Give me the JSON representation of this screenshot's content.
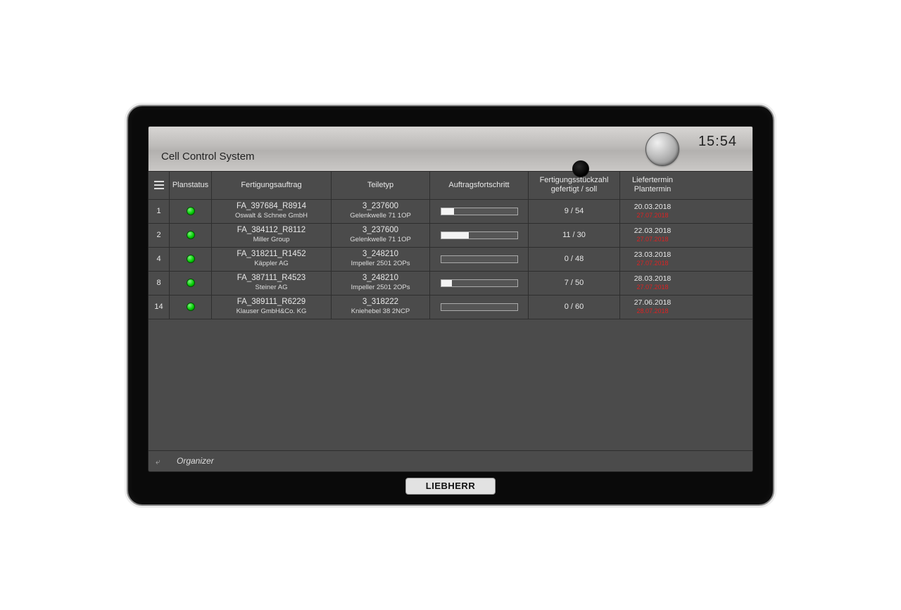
{
  "header": {
    "title": "Cell Control System",
    "time": "15:54"
  },
  "columns": {
    "menu": "≡",
    "planstatus": "Planstatus",
    "order": "Fertigungsauftrag",
    "parttype": "Teiletyp",
    "progress": "Auftragsfortschritt",
    "qty_line1": "Fertigungsstückzahl",
    "qty_line2": "gefertigt / soll",
    "date_line1": "Liefertermin",
    "date_line2": "Plantermin"
  },
  "rows": [
    {
      "num": "1",
      "status": "green",
      "order_id": "FA_397684_R8914",
      "customer": "Oswalt & Schnee GmbH",
      "part_id": "3_237600",
      "part_desc": "Gelenkwelle 71 1OP",
      "progress_pct": 17,
      "qty": "9 / 54",
      "deliver": "20.03.2018",
      "plan": "27.07.2018"
    },
    {
      "num": "2",
      "status": "green",
      "order_id": "FA_384112_R8112",
      "customer": "Miller Group",
      "part_id": "3_237600",
      "part_desc": "Gelenkwelle 71 1OP",
      "progress_pct": 37,
      "qty": "11 / 30",
      "deliver": "22.03.2018",
      "plan": "27.07.2018"
    },
    {
      "num": "4",
      "status": "green",
      "order_id": "FA_318211_R1452",
      "customer": "Käppler AG",
      "part_id": "3_248210",
      "part_desc": "Impeller 2501 2OPs",
      "progress_pct": 0,
      "qty": "0 / 48",
      "deliver": "23.03.2018",
      "plan": "27.07.2018"
    },
    {
      "num": "8",
      "status": "green",
      "order_id": "FA_387111_R4523",
      "customer": "Steiner AG",
      "part_id": "3_248210",
      "part_desc": "Impeller 2501 2OPs",
      "progress_pct": 14,
      "qty": "7 / 50",
      "deliver": "28.03.2018",
      "plan": "27.07.2018"
    },
    {
      "num": "14",
      "status": "green",
      "order_id": "FA_389111_R6229",
      "customer": "Klauser GmbH&Co. KG",
      "part_id": "3_318222",
      "part_desc": "Kniehebel 38 2NCP",
      "progress_pct": 0,
      "qty": "0 / 60",
      "deliver": "27.06.2018",
      "plan": "28.07.2018"
    }
  ],
  "footer": {
    "label": "Organizer"
  },
  "brand": "LIEBHERR"
}
